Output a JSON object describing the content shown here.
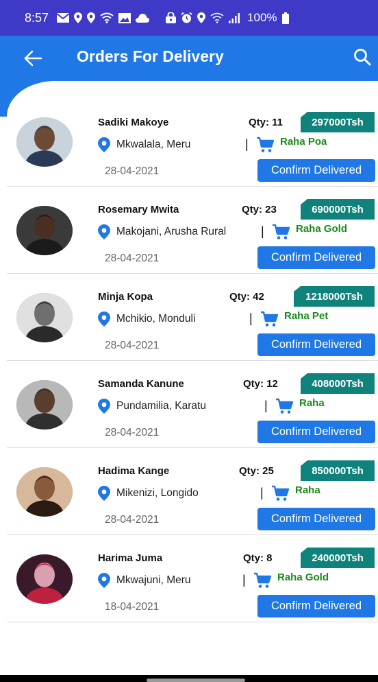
{
  "status": {
    "time": "8:57",
    "battery": "100%",
    "icons": [
      "mail-icon",
      "location-icon",
      "location-icon",
      "wifi-icon",
      "image-icon",
      "cloud-icon",
      "lock-icon",
      "alarm-icon",
      "location-icon",
      "wifi-signal-icon",
      "cell-signal-icon",
      "battery-icon"
    ]
  },
  "header": {
    "title": "Orders For Delivery",
    "back_icon": "arrow-left-icon",
    "search_icon": "search-icon"
  },
  "colors": {
    "status_bar": "#3f39c8",
    "app_bar": "#1f78e6",
    "price_badge": "#0f827b",
    "product_text": "#1a8a1a",
    "button": "#1f78e6",
    "pin": "#1f78e6"
  },
  "button_label": "Confirm Delivered",
  "orders": [
    {
      "name": "Sadiki Makoye",
      "location": "Mkwalala, Meru",
      "qty": "Qty: 11",
      "price": "297000Tsh",
      "product": "Raha Poa",
      "date": "28-04-2021"
    },
    {
      "name": "Rosemary Mwita",
      "location": "Makojani, Arusha Rural",
      "qty": "Qty: 23",
      "price": "690000Tsh",
      "product": "Raha Gold",
      "date": "28-04-2021"
    },
    {
      "name": "Minja Kopa",
      "location": "Mchikio, Monduli",
      "qty": "Qty: 42",
      "price": "1218000Tsh",
      "product": "Raha Pet",
      "date": "28-04-2021"
    },
    {
      "name": "Samanda Kanune",
      "location": "Pundamilia, Karatu",
      "qty": "Qty: 12",
      "price": "408000Tsh",
      "product": "Raha",
      "date": "28-04-2021"
    },
    {
      "name": "Hadima Kange",
      "location": "Mikenizi, Longido",
      "qty": "Qty: 25",
      "price": "850000Tsh",
      "product": "Raha",
      "date": "28-04-2021"
    },
    {
      "name": "Harima Juma",
      "location": "Mkwajuni, Meru",
      "qty": "Qty: 8",
      "price": "240000Tsh",
      "product": "Raha Gold",
      "date": "18-04-2021"
    }
  ]
}
